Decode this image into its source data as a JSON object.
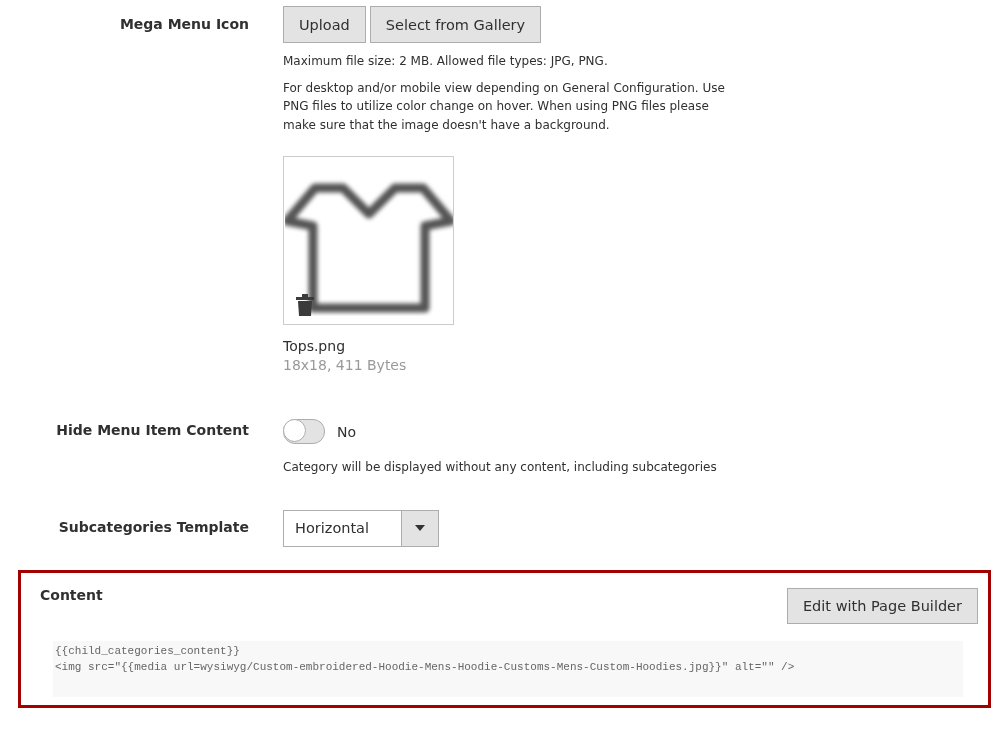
{
  "mega_menu_icon": {
    "label": "Mega Menu Icon",
    "buttons": [
      "Upload",
      "Select from Gallery"
    ],
    "notes": [
      "Maximum file size: 2 MB. Allowed file types: JPG, PNG.",
      "For desktop and/or mobile view depending on General Configuration. Use PNG files to utilize color change on hover. When using PNG files please make sure that the image doesn't have a background."
    ],
    "file": {
      "name": "Tops.png",
      "details": "18x18, 411 Bytes"
    }
  },
  "hide_menu_item_content": {
    "label": "Hide Menu Item Content",
    "on": false,
    "value_label": "No",
    "note": "Category will be displayed without any content, including subcategories"
  },
  "subcategories_template": {
    "label": "Subcategories Template",
    "value": "Horizontal"
  },
  "content": {
    "label": "Content",
    "button": "Edit with Page Builder",
    "code": [
      "{{child_categories_content}}",
      "<img src=\"{{media url=wysiwyg/Custom-embroidered-Hoodie-Mens-Hoodie-Customs-Mens-Custom-Hoodies.jpg}}\" alt=\"\" />"
    ]
  }
}
